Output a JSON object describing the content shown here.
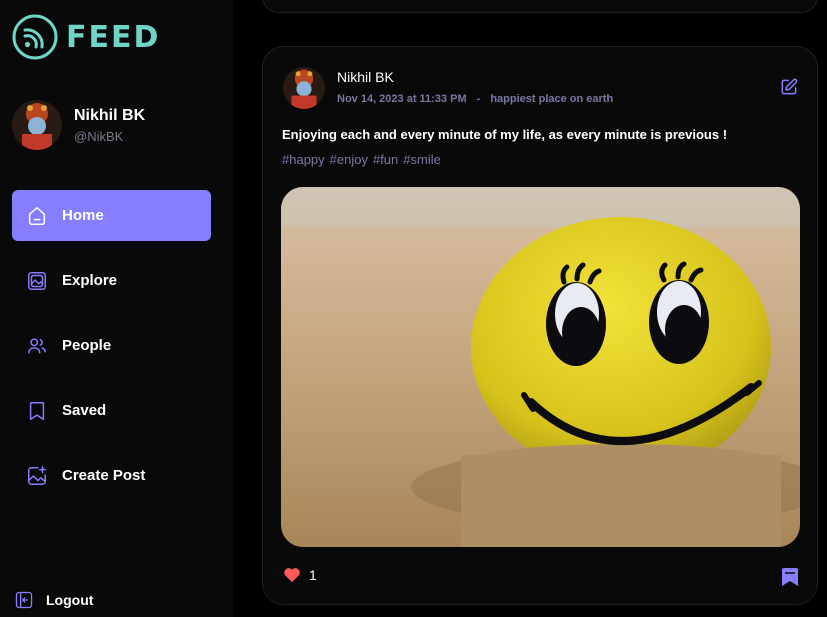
{
  "brand": {
    "name": "FEED",
    "accent": "#6fd6c7"
  },
  "user": {
    "name": "Nikhil BK",
    "handle": "@NikBK"
  },
  "nav": [
    {
      "label": "Home",
      "icon": "home-icon",
      "active": true
    },
    {
      "label": "Explore",
      "icon": "gallery-icon",
      "active": false
    },
    {
      "label": "People",
      "icon": "people-icon",
      "active": false
    },
    {
      "label": "Saved",
      "icon": "bookmark-icon",
      "active": false
    },
    {
      "label": "Create Post",
      "icon": "image-add-icon",
      "active": false
    }
  ],
  "logout_label": "Logout",
  "colors": {
    "primary": "#877eff",
    "muted": "#7878a3",
    "like": "#ff5a5a"
  },
  "post": {
    "author": "Nikhil BK",
    "date": "Nov 14, 2023 at 11:33 PM",
    "separator": "-",
    "location": "happiest place on earth",
    "caption": "Enjoying each and every minute of my life, as every minute is previous !",
    "tags": [
      "#happy",
      "#enjoy",
      "#fun",
      "#smile"
    ],
    "likes": "1"
  }
}
